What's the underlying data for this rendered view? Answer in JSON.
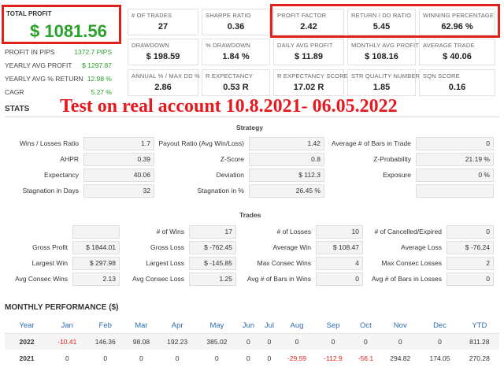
{
  "total_profit": {
    "label": "TOTAL PROFIT",
    "value": "$ 1081.56"
  },
  "side_stats": [
    {
      "label": "PROFIT IN PIPS",
      "value": "1372.7 PIPS"
    },
    {
      "label": "YEARLY AVG PROFIT",
      "value": "$ 1297.87"
    },
    {
      "label": "YEARLY AVG % RETURN",
      "value": "12.98 %"
    },
    {
      "label": "CAGR",
      "value": "5.27 %"
    }
  ],
  "tiles": [
    {
      "label": "# OF TRADES",
      "value": "27"
    },
    {
      "label": "SHARPE RATIO",
      "value": "0.36"
    },
    {
      "label": "PROFIT FACTOR",
      "value": "2.42"
    },
    {
      "label": "RETURN / DD RATIO",
      "value": "5.45"
    },
    {
      "label": "WINNING PERCENTAGE",
      "value": "62.96 %"
    },
    {
      "label": "DRAWDOWN",
      "value": "$ 198.59"
    },
    {
      "label": "% DRAWDOWN",
      "value": "1.84 %"
    },
    {
      "label": "DAILY AVG PROFIT",
      "value": "$ 11.89"
    },
    {
      "label": "MONTHLY AVG PROFIT",
      "value": "$ 108.16"
    },
    {
      "label": "AVERAGE TRADE",
      "value": "$ 40.06"
    },
    {
      "label": "ANNUAL % / MAX DD %",
      "value": "2.86"
    },
    {
      "label": "R EXPECTANCY",
      "value": "0.53 R"
    },
    {
      "label": "R EXPECTANCY SCORE",
      "value": "17.02 R"
    },
    {
      "label": "STR QUALITY NUMBER",
      "value": "1.85"
    },
    {
      "label": "SQN SCORE",
      "value": "0.16"
    }
  ],
  "stats_title": "STATS",
  "overlay_text": "Test on real account 10.8.2021- 06.05.2022",
  "strategy": {
    "title": "Strategy",
    "rows": [
      [
        "Wins / Losses Ratio",
        "1.7",
        "Payout Ratio (Avg Win/Loss)",
        "1.42",
        "Average # of Bars in Trade",
        "0"
      ],
      [
        "AHPR",
        "0.39",
        "Z-Score",
        "0.8",
        "Z-Probability",
        "21.19 %"
      ],
      [
        "Expectancy",
        "40.06",
        "Deviation",
        "$ 112.3",
        "Exposure",
        "0 %"
      ],
      [
        "Stagnation in Days",
        "32",
        "Stagnation in %",
        "26.45 %",
        "",
        ""
      ]
    ]
  },
  "trades": {
    "title": "Trades",
    "rows": [
      [
        "",
        "",
        "# of Wins",
        "17",
        "# of Losses",
        "10",
        "# of Cancelled/Expired",
        "0"
      ],
      [
        "Gross Profit",
        "$ 1844.01",
        "Gross Loss",
        "$ -762.45",
        "Average Win",
        "$ 108.47",
        "Average Loss",
        "$ -76.24"
      ],
      [
        "Largest Win",
        "$ 297.98",
        "Largest Loss",
        "$ -145.85",
        "Max Consec Wins",
        "4",
        "Max Consec Losses",
        "2"
      ],
      [
        "Avg Consec Wins",
        "2.13",
        "Avg Consec Loss",
        "1.25",
        "Avg # of Bars in Wins",
        "0",
        "Avg # of Bars in Losses",
        "0"
      ]
    ]
  },
  "monthly": {
    "title": "MONTHLY PERFORMANCE ($)",
    "headers": [
      "Year",
      "Jan",
      "Feb",
      "Mar",
      "Apr",
      "May",
      "Jun",
      "Jul",
      "Aug",
      "Sep",
      "Oct",
      "Nov",
      "Dec",
      "YTD"
    ],
    "rows": [
      [
        "2022",
        "-10.41",
        "146.36",
        "98.08",
        "192.23",
        "385.02",
        "0",
        "0",
        "0",
        "0",
        "0",
        "0",
        "0",
        "811.28"
      ],
      [
        "2021",
        "0",
        "0",
        "0",
        "0",
        "0",
        "0",
        "0",
        "-29.59",
        "-112.9",
        "-56.1",
        "294.82",
        "174.05",
        "270.28"
      ]
    ]
  },
  "colors": {
    "accent_red": "#e0201b",
    "profit_green": "#2aa12a",
    "header_blue": "#2e6bb0"
  }
}
